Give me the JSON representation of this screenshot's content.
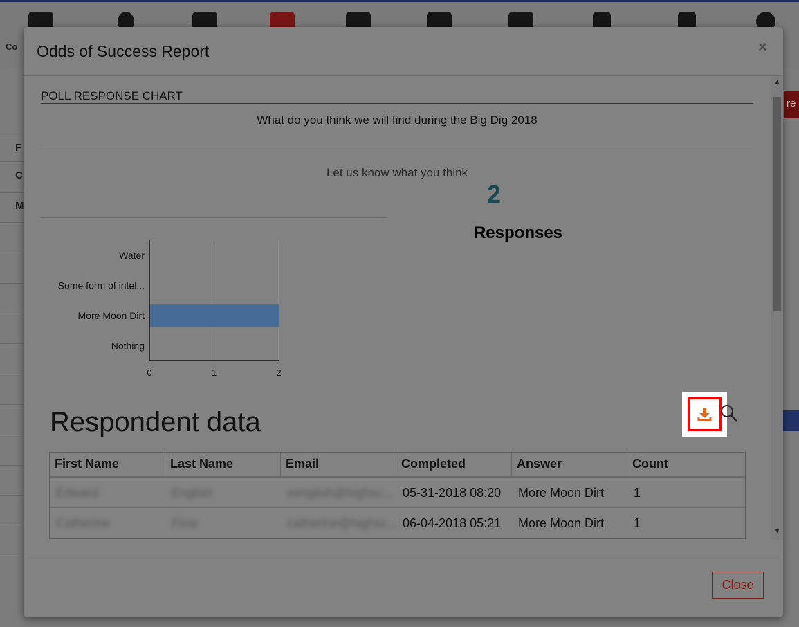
{
  "background": {
    "left_text": "Co",
    "left_letters": [
      "F",
      "C",
      "M"
    ],
    "right_fragment": "re"
  },
  "modal": {
    "title": "Odds of Success Report",
    "close_x": "×",
    "section_label": "POLL RESPONSE CHART",
    "question": "What do you think we will find during the Big Dig 2018",
    "subtext": "Let us know what you think",
    "response_count": "2",
    "response_label": "Responses",
    "respondent_title": "Respondent data",
    "table": {
      "headers": [
        "First Name",
        "Last Name",
        "Email",
        "Completed",
        "Answer",
        "Count"
      ],
      "rows": [
        [
          "Edward",
          "English",
          "eenglish@highsc...",
          "05-31-2018 08:20",
          "More Moon Dirt",
          "1"
        ],
        [
          "Catherine",
          "Flow",
          "catherine@highsc...",
          "06-04-2018 05:21",
          "More Moon Dirt",
          "1"
        ]
      ]
    },
    "footer": {
      "close_label": "Close"
    }
  },
  "icons": {
    "download": "download-icon",
    "search": "search-icon",
    "close": "close-icon"
  },
  "colors": {
    "bar": "#456b96",
    "count": "#174a52",
    "close_text": "#8a1a10",
    "download_icon": "#e8661a",
    "highlight_box": "#ff0000"
  },
  "chart_data": {
    "type": "bar",
    "orientation": "horizontal",
    "categories": [
      "Water",
      "Some form of intel...",
      "More Moon Dirt",
      "Nothing"
    ],
    "values": [
      0,
      0,
      2,
      0
    ],
    "xlim": [
      0,
      2
    ],
    "xticks": [
      "0",
      "1",
      "2"
    ],
    "grid": true
  }
}
